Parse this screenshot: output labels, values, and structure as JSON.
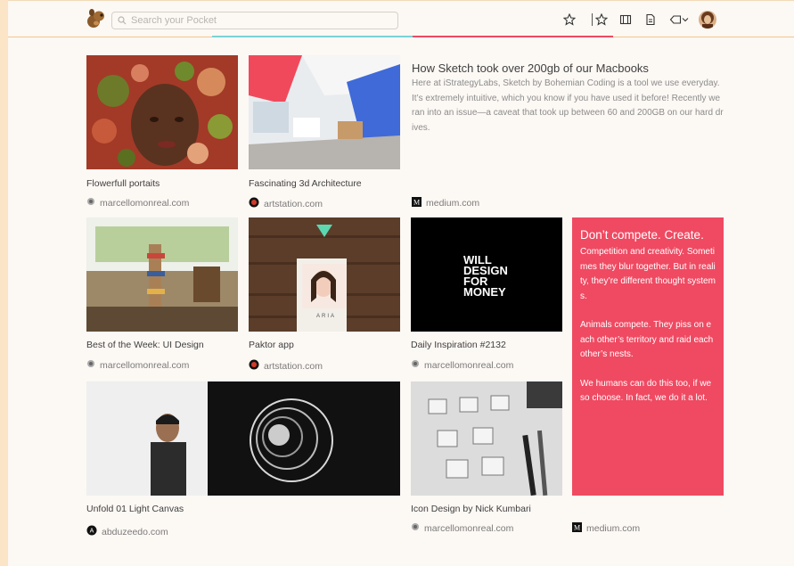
{
  "header": {
    "search_placeholder": "Search your Pocket",
    "icons": [
      "pocket-logo-icon",
      "search-icon",
      "star-icon",
      "star-outline-icon",
      "film-icon",
      "document-icon",
      "tag-icon",
      "chevron-down-icon",
      "avatar"
    ]
  },
  "colors": {
    "accent": "#ef4a62",
    "accent_teal": "#7ad3d6",
    "background": "#fcf8f4"
  },
  "cards": [
    {
      "title": "Flowerfull portaits",
      "source": "marcellomonreal.com"
    },
    {
      "title": "Fascinating 3d Architecture",
      "source": "artstation.com"
    },
    {
      "title": "How Sketch took over 200gb of our Macbooks",
      "excerpt": "Here at iStrategyLabs, Sketch by Bohemian Coding is a tool we use everyday. It’s extremely intuitive, which you know if you have used it before! Recently we ran into an issue—a caveat that took up between 60 and 200GB on our hard drives.",
      "source": "medium.com"
    },
    {
      "title": "Best of the Week: UI Design",
      "source": "marcellomonreal.com"
    },
    {
      "title": "Paktor app",
      "source": "artstation.com",
      "image_text": "ARIA"
    },
    {
      "title": "Daily Inspiration #2132",
      "source": "marcellomonreal.com",
      "image_text": [
        "WILL",
        "DESIGN",
        "FOR",
        "MONEY"
      ]
    },
    {
      "title": "Don’t compete. Create.",
      "paragraphs": [
        "Competition and creativity. Sometimes they blur together. But in reality, they’re different thought systems.",
        "Animals compete. They piss on each other’s territory and raid each other’s nests.",
        "We humans can do this too, if we so choose. In fact, we do it a lot."
      ],
      "source": "medium.com"
    },
    {
      "title": "Unfold 01 Light Canvas",
      "source": "abduzeedo.com"
    },
    {
      "title": "Icon Design by Nick Kumbari",
      "source": "marcellomonreal.com"
    }
  ]
}
